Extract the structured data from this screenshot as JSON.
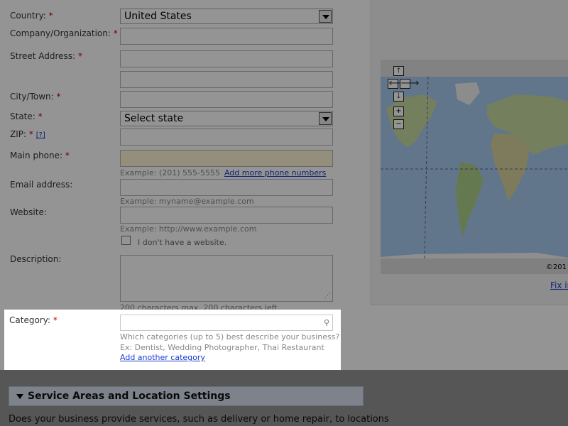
{
  "form": {
    "country": {
      "label": "Country:",
      "required": "*",
      "value": "United States"
    },
    "company": {
      "label": "Company/Organization:",
      "required": "*"
    },
    "street": {
      "label": "Street Address:",
      "required": "*"
    },
    "city": {
      "label": "City/Town:",
      "required": "*"
    },
    "state": {
      "label": "State:",
      "required": "*",
      "value": "Select state"
    },
    "zip": {
      "label": "ZIP:",
      "required": "*",
      "help": "[?]"
    },
    "phone": {
      "label": "Main phone:",
      "required": "*",
      "example": "Example: (201) 555-5555",
      "add_link": "Add more phone numbers"
    },
    "email": {
      "label": "Email address:",
      "example": "Example: myname@example.com"
    },
    "website": {
      "label": "Website:",
      "example": "Example: http://www.example.com",
      "no_site_label": "I don't have a website."
    },
    "description": {
      "label": "Description:",
      "counter": "200 characters max, 200 characters left."
    },
    "category": {
      "label": "Category:",
      "required": "*",
      "hint1": "Which categories (up to 5) best describe your business?",
      "hint2": "Ex: Dentist, Wedding Photographer, Thai Restaurant",
      "add_link": "Add another category"
    }
  },
  "map": {
    "copyright": "©201",
    "fix_link": "Fix in",
    "nav": {
      "up": "🡑",
      "left": "🡐",
      "right": "🡒",
      "down": "🡓",
      "zoom_in": "+",
      "zoom_out": "−"
    }
  },
  "section": {
    "title": "Service Areas and Location Settings"
  },
  "service_question": "Does your business provide services, such as delivery or home repair, to locations",
  "colors": {
    "required": "#cc0000",
    "link": "#1a3ecf",
    "section_bg": "#d9e1ee",
    "phone_field_bg": "#fff7d8"
  }
}
